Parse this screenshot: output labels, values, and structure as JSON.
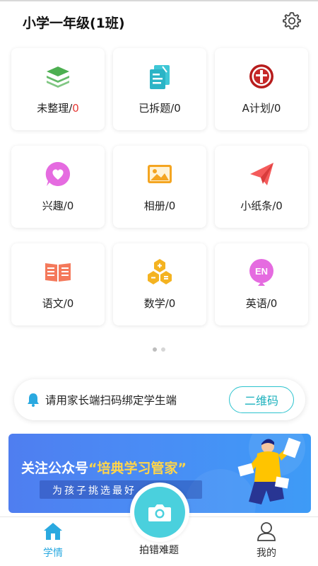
{
  "header": {
    "title": "小学一年级(1班)",
    "settings_icon": "gear-icon"
  },
  "tiles": [
    {
      "name": "未整理",
      "count": "0",
      "count_color": "#e53935",
      "icon": "stacked-layers-icon"
    },
    {
      "name": "已拆题",
      "count": "0",
      "icon": "documents-icon"
    },
    {
      "name": "A计划",
      "count": "0",
      "icon": "seal-emblem-icon"
    },
    {
      "name": "兴趣",
      "count": "0",
      "icon": "heart-bubble-icon"
    },
    {
      "name": "相册",
      "count": "0",
      "icon": "photo-icon"
    },
    {
      "name": "小纸条",
      "count": "0",
      "icon": "paper-plane-icon"
    },
    {
      "name": "语文",
      "count": "0",
      "icon": "open-book-icon"
    },
    {
      "name": "数学",
      "count": "0",
      "icon": "math-blocks-icon"
    },
    {
      "name": "英语",
      "count": "0",
      "icon": "en-badge-icon"
    }
  ],
  "pager": {
    "total": 2,
    "active": 0
  },
  "notice": {
    "text": "请用家长端扫码绑定学生端",
    "button": "二维码",
    "icon": "bell-icon"
  },
  "banner": {
    "title_prefix": "关注公众号",
    "title_highlight": "“培典学习管家”",
    "subtitle": "为孩子挑选最好"
  },
  "tabbar": {
    "home": "学情",
    "center": "拍错难题",
    "mine": "我的"
  },
  "colors": {
    "accent": "#2aa9e0",
    "teal": "#4ad0dd",
    "banner": "#4a8cf5"
  }
}
